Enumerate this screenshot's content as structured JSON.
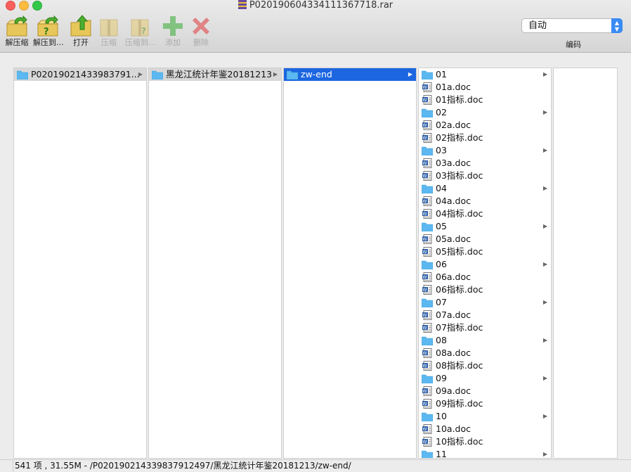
{
  "window": {
    "title": "P020190604334111367718.rar"
  },
  "toolbar": {
    "extract": "解压缩",
    "extract_to": "解压到...",
    "open": "打开",
    "compress": "压缩",
    "compress_to": "压缩到...",
    "add": "添加",
    "delete": "删除"
  },
  "encoding": {
    "value": "自动",
    "label": "编码"
  },
  "columns": {
    "col1": "P02019021433983791...",
    "col2": "黑龙江统计年鉴20181213",
    "col3": "zw-end",
    "col4": [
      {
        "name": "01",
        "type": "folder"
      },
      {
        "name": "01a.doc",
        "type": "doc"
      },
      {
        "name": "01指标.doc",
        "type": "doc"
      },
      {
        "name": "02",
        "type": "folder"
      },
      {
        "name": "02a.doc",
        "type": "doc"
      },
      {
        "name": "02指标.doc",
        "type": "doc"
      },
      {
        "name": "03",
        "type": "folder"
      },
      {
        "name": "03a.doc",
        "type": "doc"
      },
      {
        "name": "03指标.doc",
        "type": "doc"
      },
      {
        "name": "04",
        "type": "folder"
      },
      {
        "name": "04a.doc",
        "type": "doc"
      },
      {
        "name": "04指标.doc",
        "type": "doc"
      },
      {
        "name": "05",
        "type": "folder"
      },
      {
        "name": "05a.doc",
        "type": "doc"
      },
      {
        "name": "05指标.doc",
        "type": "doc"
      },
      {
        "name": "06",
        "type": "folder"
      },
      {
        "name": "06a.doc",
        "type": "doc"
      },
      {
        "name": "06指标.doc",
        "type": "doc"
      },
      {
        "name": "07",
        "type": "folder"
      },
      {
        "name": "07a.doc",
        "type": "doc"
      },
      {
        "name": "07指标.doc",
        "type": "doc"
      },
      {
        "name": "08",
        "type": "folder"
      },
      {
        "name": "08a.doc",
        "type": "doc"
      },
      {
        "name": "08指标.doc",
        "type": "doc"
      },
      {
        "name": "09",
        "type": "folder"
      },
      {
        "name": "09a.doc",
        "type": "doc"
      },
      {
        "name": "09指标.doc",
        "type": "doc"
      },
      {
        "name": "10",
        "type": "folder"
      },
      {
        "name": "10a.doc",
        "type": "doc"
      },
      {
        "name": "10指标.doc",
        "type": "doc"
      },
      {
        "name": "11",
        "type": "folder"
      }
    ]
  },
  "status": {
    "text": "541 项 , 31.55M - /P020190214339837912497/黑龙江统计年鉴20181213/zw-end/"
  },
  "colors": {
    "selection": "#1c66e0",
    "folder": "#5cb8f0"
  },
  "icons": [
    "folder-icon",
    "doc-icon",
    "chevron-right-icon"
  ]
}
